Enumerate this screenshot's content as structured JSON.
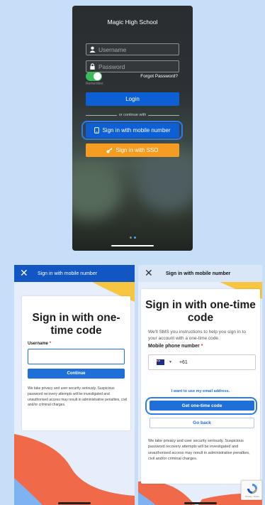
{
  "login_screen": {
    "school_name": "Magic High School",
    "username_placeholder": "Username",
    "password_placeholder": "Password",
    "remember_label": "Remember",
    "remember_enabled": true,
    "forgot_password": "Forgot Password?",
    "login_button": "Login",
    "divider_text": "or continue with",
    "mobile_button": "Sign in with mobile number",
    "sso_button": "Sign in with SSO",
    "page_indicator": {
      "count": 2,
      "active": 1
    }
  },
  "username_screen": {
    "header_title": "Sign in with mobile number",
    "card_title": "Sign in with one-time code",
    "username_label": "Username",
    "required_marker": "*",
    "continue_button": "Continue",
    "security_note": "We take privacy and user security seriously. Suspicious password recovery attempts will be investigated and unauthorised access may result in administrative penalties, civil and/or criminal charges."
  },
  "phone_screen": {
    "header_title": "Sign in with mobile number",
    "card_title": "Sign in with one-time code",
    "intro": "We'll SMS you instructions to help you sign in to your account with a one-time code.",
    "phone_label": "Mobile phone number",
    "required_marker": "*",
    "country_code": "+61",
    "email_link": "I want to use my email address.",
    "get_code_button": "Get one-time code",
    "go_back_button": "Go back",
    "security_note": "We take privacy and user security seriously. Suspicious password recovery attempts will be investigated and unauthorised access may result in administrative penalties, civil and/or criminal charges.",
    "recaptcha_text": "Privacy - Terms"
  },
  "colors": {
    "page_bg": "#c7def8",
    "primary_blue": "#1f6fd8",
    "highlight_ring": "#2a7df0",
    "sso_orange": "#f59c22",
    "toggle_green": "#3dbb5a",
    "wave_coral": "#f06a4a",
    "wave_yellow": "#f7c53f",
    "wave_blue": "#7fb2f0"
  }
}
